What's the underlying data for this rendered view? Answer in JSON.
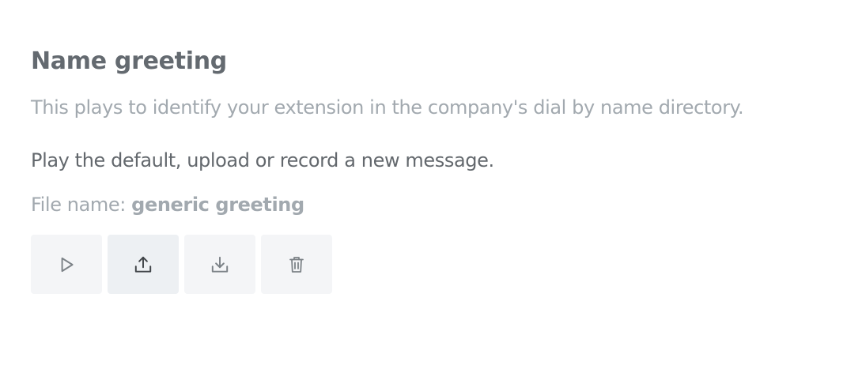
{
  "greeting": {
    "title": "Name greeting",
    "description": "This plays to identify your extension in the company's dial by name directory.",
    "instruction": "Play the default, upload or record a new message.",
    "file_label": "File name: ",
    "file_name": "generic greeting"
  },
  "actions": [
    {
      "icon": "play-icon"
    },
    {
      "icon": "upload-icon"
    },
    {
      "icon": "download-icon"
    },
    {
      "icon": "trash-icon"
    }
  ],
  "colors": {
    "title": "#646a70",
    "muted_text": "#a2a9af",
    "body_text": "#63686d",
    "button_bg": "#f4f5f7",
    "button_bg_active": "#edf0f3",
    "icon": "#7c8287",
    "icon_active": "#3f4347"
  }
}
